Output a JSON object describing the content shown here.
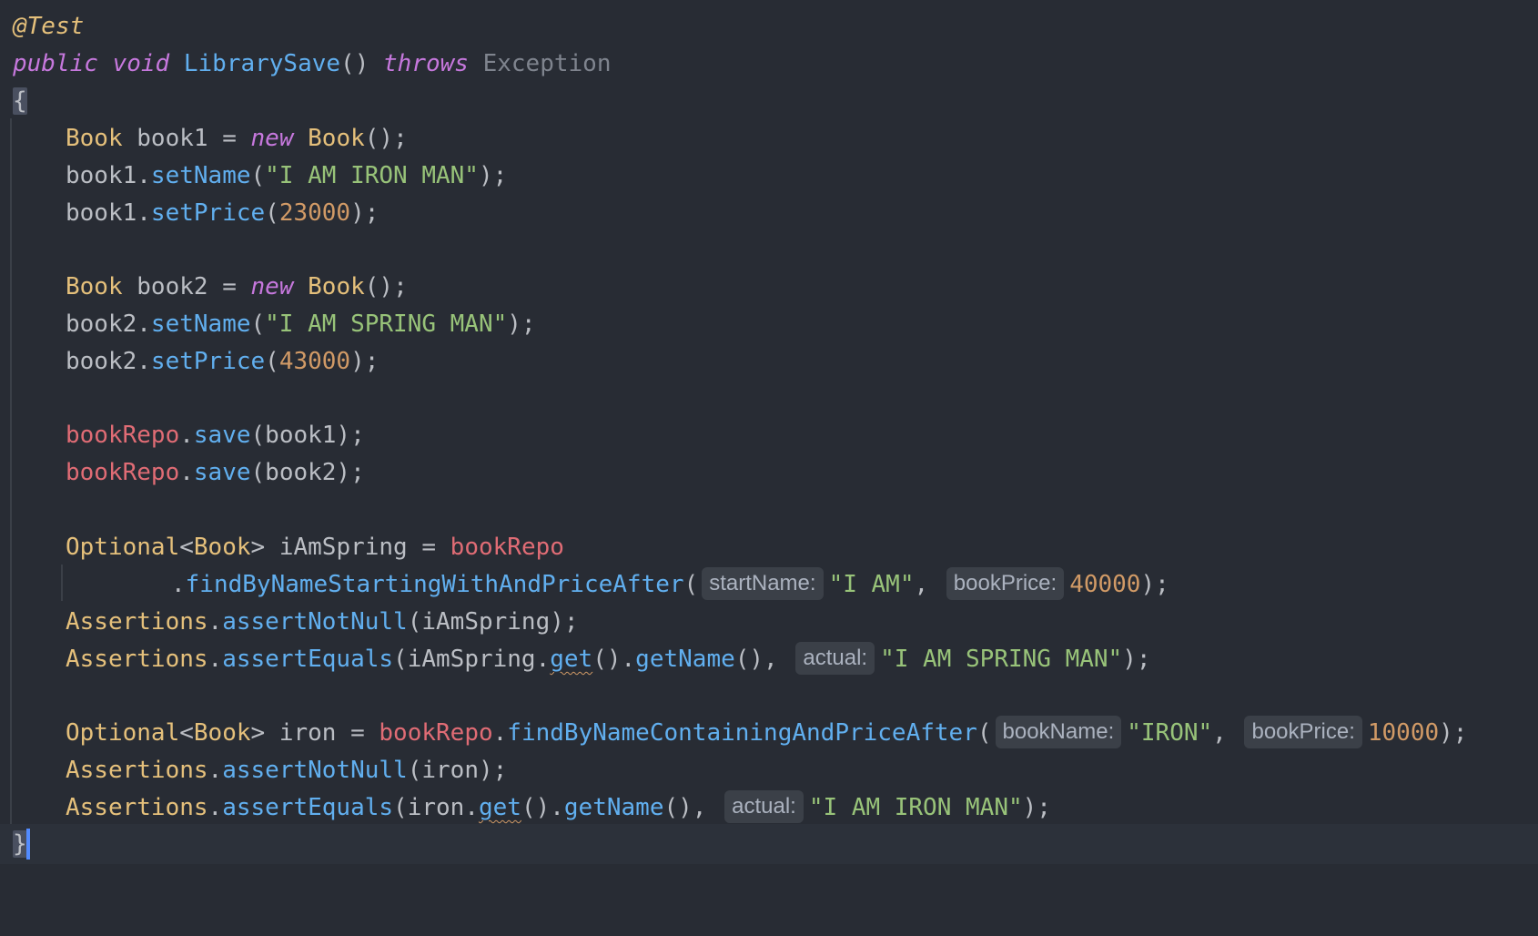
{
  "editor": {
    "theme_colors": {
      "background": "#282c34",
      "current_line": "#2c313a",
      "keyword": "#c678dd",
      "method": "#61afef",
      "type": "#e5c07b",
      "string": "#98c379",
      "number": "#d19a66",
      "field": "#e06c75",
      "caret": "#528bff"
    },
    "lines": {
      "l1": {
        "annotation": "@Test"
      },
      "l2": {
        "kw_public": "public",
        "kw_void": "void",
        "method": "LibrarySave",
        "parens": "()",
        "kw_throws": "throws",
        "exception": "Exception"
      },
      "l3": {
        "brace": "{"
      },
      "l4": {
        "type1": "Book",
        "var": " book1 = ",
        "kw_new": "new",
        "type2": "Book",
        "tail": "();"
      },
      "l5": {
        "obj": "book1.",
        "method": "setName",
        "open": "(",
        "str": "\"I AM IRON MAN\"",
        "close": ");"
      },
      "l6": {
        "obj": "book1.",
        "method": "setPrice",
        "open": "(",
        "num": "23000",
        "close": ");"
      },
      "l7": {
        "type1": "Book",
        "var": " book2 = ",
        "kw_new": "new",
        "type2": "Book",
        "tail": "();"
      },
      "l8": {
        "obj": "book2.",
        "method": "setName",
        "open": "(",
        "str": "\"I AM SPRING MAN\"",
        "close": ");"
      },
      "l9": {
        "obj": "book2.",
        "method": "setPrice",
        "open": "(",
        "num": "43000",
        "close": ");"
      },
      "l10": {
        "field": "bookRepo",
        "dot": ".",
        "method": "save",
        "args": "(book1);"
      },
      "l11": {
        "field": "bookRepo",
        "dot": ".",
        "method": "save",
        "args": "(book2);"
      },
      "l12": {
        "type": "Optional",
        "generic_open": "<",
        "generic_type": "Book",
        "generic_close": ">",
        "var": " iAmSpring = ",
        "field": "bookRepo"
      },
      "l13": {
        "dot": ".",
        "method": "findByNameStartingWithAndPriceAfter",
        "open": "(",
        "hint1": "startName:",
        "str": "\"I AM\"",
        "comma": ",",
        "hint2": "bookPrice:",
        "num": "40000",
        "close": ");"
      },
      "l14": {
        "type": "Assertions",
        "dot": ".",
        "method": "assertNotNull",
        "args": "(iAmSpring);"
      },
      "l15": {
        "type": "Assertions",
        "dot": ".",
        "method": "assertEquals",
        "open": "(iAmSpring.",
        "get": "get",
        "mid": "().",
        "method2": "getName",
        "mid2": "(),",
        "hint": "actual:",
        "str": "\"I AM SPRING MAN\"",
        "close": ");"
      },
      "l16": {
        "type": "Optional",
        "generic_open": "<",
        "generic_type": "Book",
        "generic_close": ">",
        "var": " iron = ",
        "field": "bookRepo",
        "dot": ".",
        "method": "findByNameContainingAndPriceAfter",
        "open": "(",
        "hint1": "bookName:",
        "str": "\"IRON\"",
        "comma": ",",
        "hint2": "bookPrice:",
        "num": "10000",
        "close": ");"
      },
      "l17": {
        "type": "Assertions",
        "dot": ".",
        "method": "assertNotNull",
        "args": "(iron);"
      },
      "l18": {
        "type": "Assertions",
        "dot": ".",
        "method": "assertEquals",
        "open": "(iron.",
        "get": "get",
        "mid": "().",
        "method2": "getName",
        "mid2": "(),",
        "hint": "actual:",
        "str": "\"I AM IRON MAN\"",
        "close": ");"
      },
      "l19": {
        "brace": "}"
      }
    }
  }
}
